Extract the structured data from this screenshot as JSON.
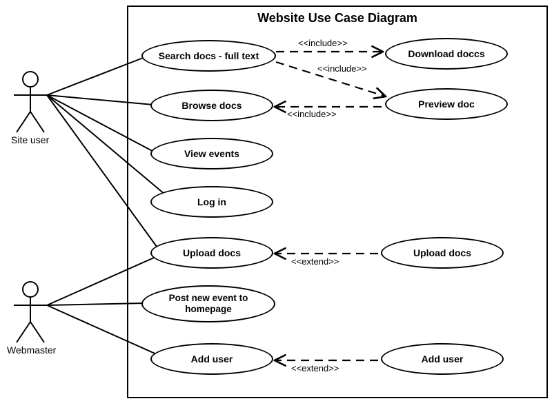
{
  "title": "Website Use Case Diagram",
  "actors": {
    "site_user": "Site user",
    "webmaster": "Webmaster"
  },
  "usecases": {
    "search_docs": "Search docs - full text",
    "browse_docs": "Browse docs",
    "view_events": "View events",
    "log_in": "Log in",
    "upload_docs_left": "Upload docs",
    "post_event": "Post new event to homepage",
    "add_user_left": "Add user",
    "download_doccs": "Download doccs",
    "preview_doc": "Preview doc",
    "upload_docs_right": "Upload docs",
    "add_user_right": "Add user"
  },
  "rels": {
    "include1": "<<include>>",
    "include2": "<<include>>",
    "include3": "<<include>>",
    "extend1": "<<extend>>",
    "extend2": "<<extend>>"
  }
}
